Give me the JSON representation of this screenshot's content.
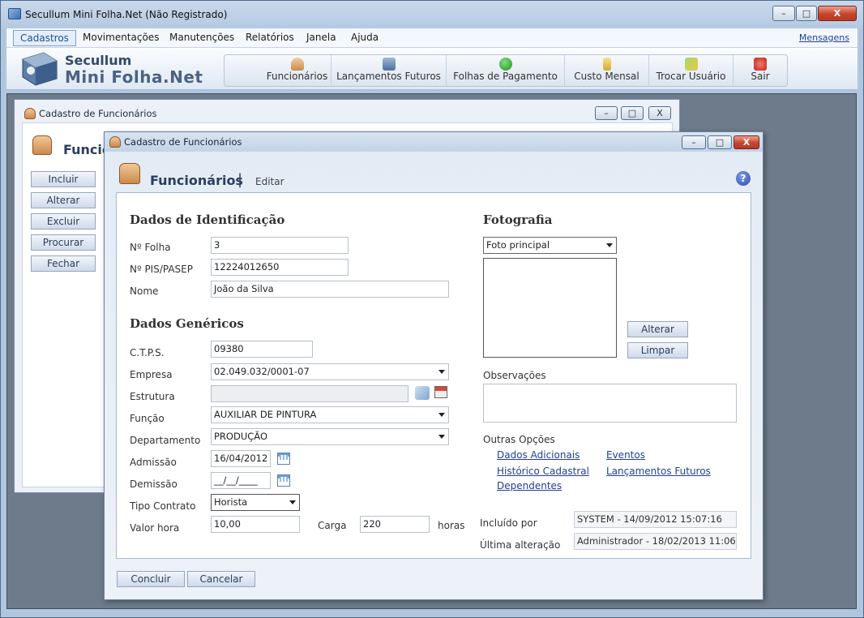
{
  "app": {
    "title": "Secullum Mini Folha.Net (Não Registrado)",
    "brand_line1": "Secullum",
    "brand_line2": "Mini Folha.Net",
    "min": "–",
    "max": "□",
    "close": "X"
  },
  "menu": {
    "items": [
      "Cadastros",
      "Movimentações",
      "Manutenções",
      "Relatórios",
      "Janela",
      "Ajuda"
    ],
    "messages": "Mensagens"
  },
  "toolbar": {
    "items": [
      "Funcionários",
      "Lançamentos Futuros",
      "Folhas de Pagamento",
      "Custo Mensal",
      "Trocar Usuário",
      "Sair"
    ]
  },
  "bgwin": {
    "title": "Cadastro de Funcionários",
    "heading": "Funcio",
    "buttons": [
      "Incluir",
      "Alterar",
      "Excluir",
      "Procurar",
      "Fechar"
    ]
  },
  "dialog": {
    "title": "Cadastro de Funcionários",
    "heading": "Funcionários",
    "separator": "|",
    "mode": "Editar",
    "help": "?",
    "ident": {
      "section": "Dados de Identificação",
      "folha_label": "Nº Folha",
      "folha": "3",
      "pis_label": "Nº PIS/PASEP",
      "pis": "12224012650",
      "nome_label": "Nome",
      "nome": "João da Silva"
    },
    "generic": {
      "section": "Dados Genéricos",
      "ctps_label": "C.T.P.S.",
      "ctps": "09380",
      "empresa_label": "Empresa",
      "empresa": "02.049.032/0001-07",
      "estrutura_label": "Estrutura",
      "estrutura": "",
      "funcao_label": "Função",
      "funcao": "AUXILIAR DE PINTURA",
      "depto_label": "Departamento",
      "depto": "PRODUÇÃO",
      "admissao_label": "Admissão",
      "admissao": "16/04/2012",
      "demissao_label": "Demissão",
      "demissao": "__/__/____",
      "contrato_label": "Tipo Contrato",
      "contrato": "Horista",
      "valor_label": "Valor hora",
      "valor": "10,00",
      "carga_label": "Carga",
      "carga": "220",
      "horas": "horas"
    },
    "photo": {
      "section": "Fotografia",
      "select": "Foto principal",
      "alterar": "Alterar",
      "limpar": "Limpar"
    },
    "obs_label": "Observações",
    "outras": {
      "label": "Outras Opções",
      "links": [
        "Dados Adicionais",
        "Eventos",
        "Histórico Cadastral",
        "Lançamentos Futuros",
        "Dependentes"
      ]
    },
    "audit": {
      "incluido_label": "Incluído por",
      "incluido": "SYSTEM - 14/09/2012 15:07:16",
      "alteracao_label": "Última alteração",
      "alteracao": "Administrador - 18/02/2013 11:06"
    },
    "concluir": "Concluir",
    "cancelar": "Cancelar"
  }
}
